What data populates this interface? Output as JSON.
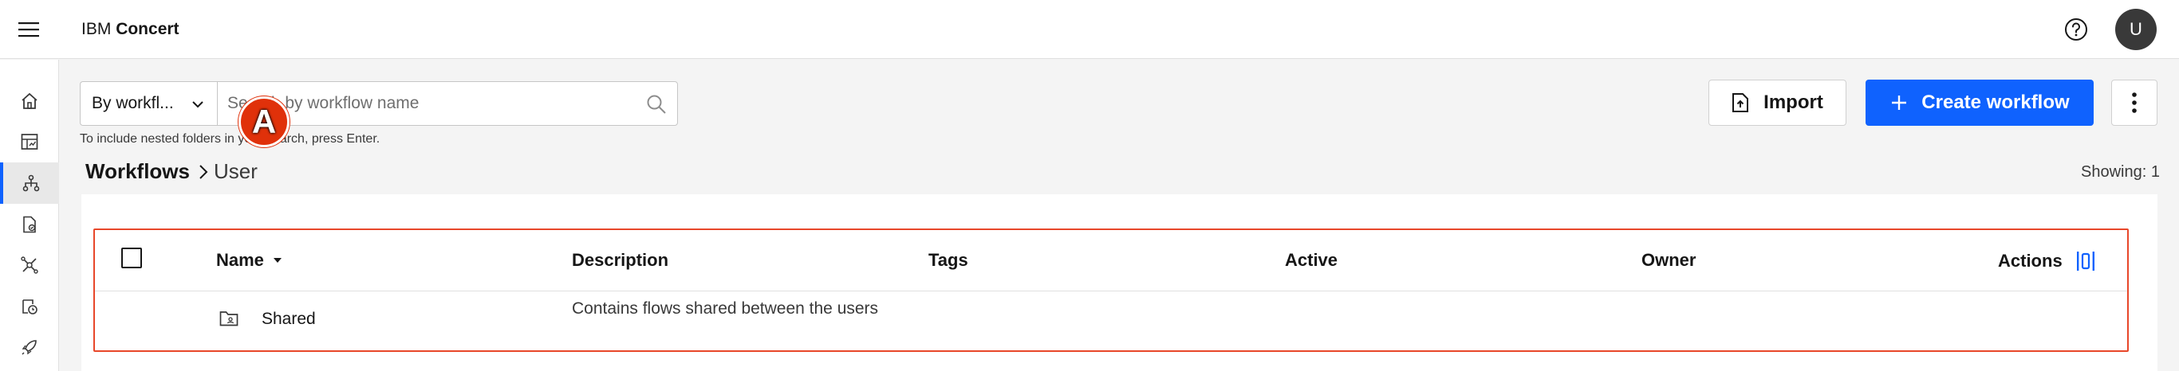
{
  "header": {
    "brand_prefix": "IBM",
    "brand_name": "Concert",
    "avatar_initial": "U"
  },
  "sidebar": {
    "items": [
      {
        "icon": "home-icon"
      },
      {
        "icon": "dashboard-icon"
      },
      {
        "icon": "workflow-icon",
        "active": true
      },
      {
        "icon": "document-icon"
      },
      {
        "icon": "integration-icon"
      },
      {
        "icon": "schedule-icon"
      },
      {
        "icon": "rocket-icon"
      }
    ]
  },
  "toolbar": {
    "filter_value": "By workfl...",
    "search_placeholder": "Search by workflow name",
    "search_value": "",
    "hint": "To include nested folders in your search, press Enter.",
    "import_label": "Import",
    "create_label": "Create workflow"
  },
  "breadcrumb": {
    "root": "Workflows",
    "current": "User"
  },
  "marker_label": "A",
  "showing": "Showing: 1",
  "table": {
    "columns": {
      "name": "Name",
      "description": "Description",
      "tags": "Tags",
      "active": "Active",
      "owner": "Owner",
      "actions": "Actions"
    },
    "rows": [
      {
        "name": "Shared",
        "description": "Contains flows shared between the users",
        "tags": "",
        "active": "",
        "owner": ""
      }
    ]
  },
  "colors": {
    "primary": "#0f62fe",
    "highlight": "#e8472a",
    "marker": "#e0310a"
  }
}
